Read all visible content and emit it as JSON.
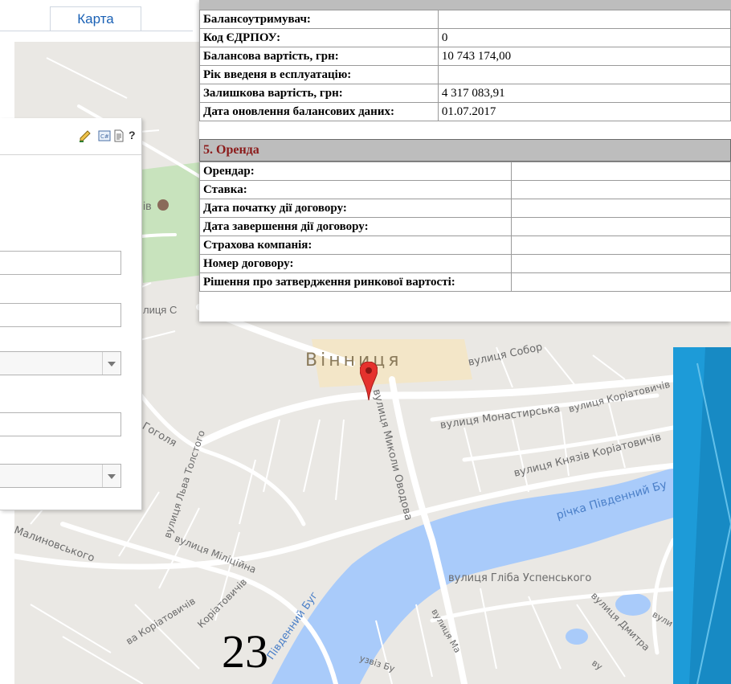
{
  "tab": {
    "label": "Карта"
  },
  "form": {
    "toolbar_help": "?",
    "map_fragment": "ів",
    "street_fragment": "лиця С"
  },
  "balance": {
    "rows": [
      {
        "label": "Балансоутримувач:",
        "value": ""
      },
      {
        "label": "Код ЄДРПОУ:",
        "value": "0"
      },
      {
        "label": "Балансова вартість, грн:",
        "value": "10 743 174,00"
      },
      {
        "label": "Рік введеня в есплуатацію:",
        "value": ""
      },
      {
        "label": "Залишкова вартість, грн:",
        "value": "4 317 083,91"
      },
      {
        "label": "Дата оновлення балансових даних:",
        "value": "01.07.2017"
      }
    ]
  },
  "rent": {
    "title": "5. Оренда",
    "rows": [
      {
        "label": "Орендар:",
        "value": ""
      },
      {
        "label": "Ставка:",
        "value": ""
      },
      {
        "label": "Дата початку дії договору:",
        "value": ""
      },
      {
        "label": "Дата завершення дії договору:",
        "value": ""
      },
      {
        "label": "Страхова компанія:",
        "value": ""
      },
      {
        "label": "Номер договору:",
        "value": ""
      },
      {
        "label": "Рішення про затвердження ринкової вартості:",
        "value": ""
      }
    ]
  },
  "map": {
    "city": "Вінниця",
    "labels": {
      "sobor": "вулиця Собор",
      "monastyrska": "вулиця Монастирська",
      "koriatovychiv_top": "вулиця Коріатовичів",
      "kniaziv": "вулиця Князів Коріатовичів",
      "ovodova": "вулиця Миколи Оводова",
      "pivdennyi_buh_river": "річка Південний Бу",
      "hohola": "Гоголя",
      "tolstoho": "вулиця Льва Толстого",
      "militsiina": "вулиця Міліційна",
      "malynovskoho": "Малиновського",
      "koriatovychiv_bottom": "Коріатовичів",
      "hliba": "вулиця Гліба Успенського",
      "dmytra": "вулиця Дмитра",
      "pivdennyi_buh": "Південний Буг",
      "vul_right": "вули",
      "uzviz": "узвіз Бу",
      "vul_ma": "вулиця Ма",
      "vu_bottom": "ву",
      "vul_koria_bottom": "ва Коріатовичів"
    }
  },
  "colors": {
    "water": "#a9cbfa",
    "road": "#ffffff",
    "land": "#eae8e4",
    "park": "#c8e3bd",
    "slide_blue": "#1d9bd8",
    "section_text": "#8b1a1a"
  },
  "page_number": "23"
}
